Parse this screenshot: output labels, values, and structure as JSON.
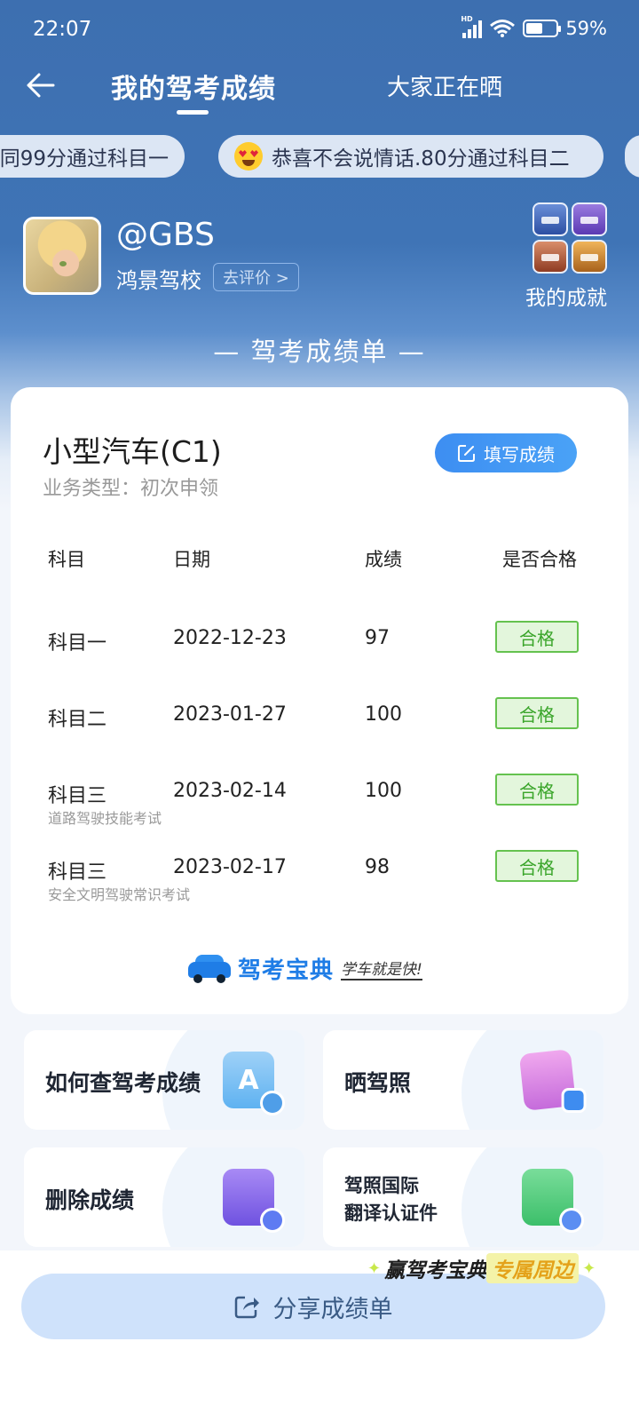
{
  "status_bar": {
    "time": "22:07",
    "network": "HD",
    "battery": "59%"
  },
  "nav": {
    "tab_active": "我的驾考成绩",
    "tab_other": "大家正在晒"
  },
  "ticker": {
    "item1": "同99分通过科目一",
    "item2": "恭喜不会说情话.80分通过科目二"
  },
  "profile": {
    "username": "@GBS",
    "school": "鸿景驾校",
    "rate_button": "去评价 >",
    "achievements_label": "我的成就"
  },
  "sheet_title": "— 驾考成绩单 —",
  "card": {
    "vehicle": "小型汽车(C1)",
    "business_type": "业务类型：初次申领",
    "fill_button": "填写成绩",
    "headers": [
      "科目",
      "日期",
      "成绩",
      "是否合格"
    ],
    "rows": [
      {
        "subject": "科目一",
        "date": "2022-12-23",
        "score": "97",
        "result": "合格",
        "sub": ""
      },
      {
        "subject": "科目二",
        "date": "2023-01-27",
        "score": "100",
        "result": "合格",
        "sub": ""
      },
      {
        "subject": "科目三",
        "date": "2023-02-14",
        "score": "100",
        "result": "合格",
        "sub": "道路驾驶技能考试"
      },
      {
        "subject": "科目三",
        "date": "2023-02-17",
        "score": "98",
        "result": "合格",
        "sub": "安全文明驾驶常识考试"
      }
    ],
    "brand_name": "驾考宝典",
    "brand_slogan": "学车就是快!"
  },
  "tiles": {
    "how_to_check": "如何查驾考成绩",
    "show_license": "晒驾照",
    "delete_scores": "删除成绩",
    "intl_line1": "驾照国际",
    "intl_line2": "翻译认证件"
  },
  "promo": {
    "part1": "赢驾考宝典",
    "part2": "专属周边"
  },
  "share_button": "分享成绩单",
  "colors": {
    "header_blue": "#3d6fb0",
    "accent": "#3d8ef2",
    "pass_green": "#65c24f"
  }
}
